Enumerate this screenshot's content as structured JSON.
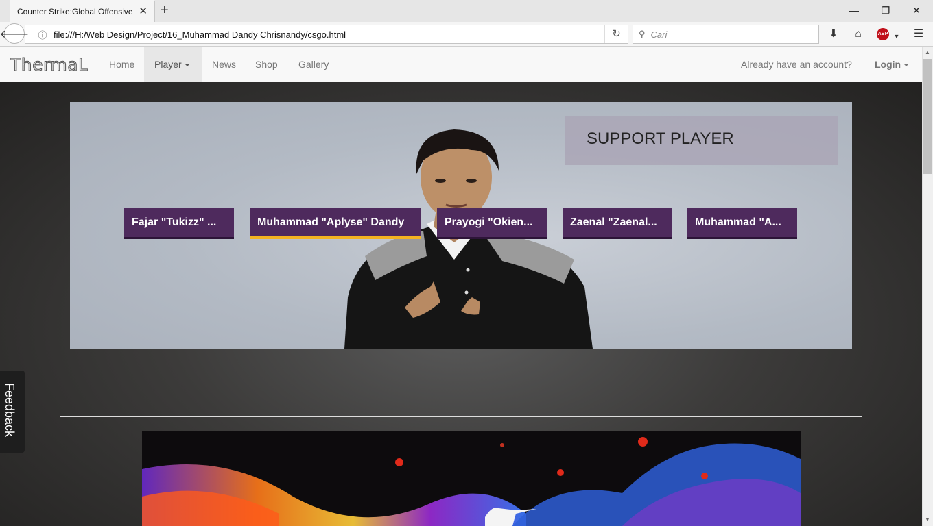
{
  "browser": {
    "tab_title": "Counter Strike:Global Offensive",
    "url": "file:///H:/Web Design/Project/16_Muhammad Dandy Chrisnandy/csgo.html",
    "search_placeholder": "Cari",
    "abp_label": "ABP"
  },
  "site": {
    "brand": "ThermaL",
    "nav": [
      "Home",
      "Player",
      "News",
      "Shop",
      "Gallery"
    ],
    "account_prompt": "Already have an account?",
    "login": "Login"
  },
  "carousel": {
    "caption": "SUPPORT PLAYER",
    "players": [
      "Fajar \"Tukizz\" ...",
      "Muhammad \"Aplyse\" Dandy",
      "Prayogi \"Okien...",
      "Zaenal \"Zaenal...",
      "Muhammad \"A..."
    ],
    "active_index": 1
  },
  "feedback_label": "Feedback",
  "colors": {
    "player_button": "#4e2a5d",
    "active_underline": "#f3b321"
  }
}
